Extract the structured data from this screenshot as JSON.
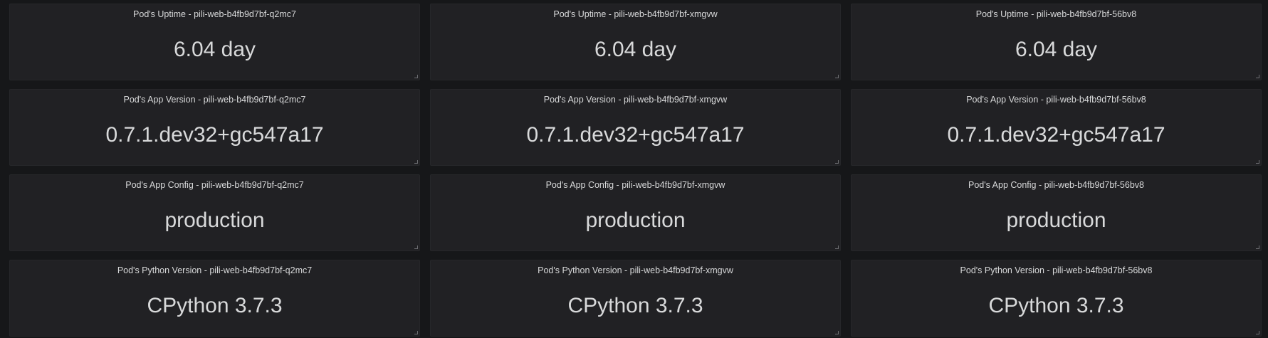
{
  "icons": {
    "resize": "resize-handle-icon"
  },
  "colors": {
    "background": "#161719",
    "panel": "#212124",
    "text": "#d8d9da"
  },
  "panels": [
    {
      "title": "Pod's Uptime - pili-web-b4fb9d7bf-q2mc7",
      "value": "6.04 day"
    },
    {
      "title": "Pod's Uptime - pili-web-b4fb9d7bf-xmgvw",
      "value": "6.04 day"
    },
    {
      "title": "Pod's Uptime - pili-web-b4fb9d7bf-56bv8",
      "value": "6.04 day"
    },
    {
      "title": "Pod's App Version - pili-web-b4fb9d7bf-q2mc7",
      "value": "0.7.1.dev32+gc547a17"
    },
    {
      "title": "Pod's App Version - pili-web-b4fb9d7bf-xmgvw",
      "value": "0.7.1.dev32+gc547a17"
    },
    {
      "title": "Pod's App Version - pili-web-b4fb9d7bf-56bv8",
      "value": "0.7.1.dev32+gc547a17"
    },
    {
      "title": "Pod's App Config - pili-web-b4fb9d7bf-q2mc7",
      "value": "production"
    },
    {
      "title": "Pod's App Config - pili-web-b4fb9d7bf-xmgvw",
      "value": "production"
    },
    {
      "title": "Pod's App Config - pili-web-b4fb9d7bf-56bv8",
      "value": "production"
    },
    {
      "title": "Pod's Python Version - pili-web-b4fb9d7bf-q2mc7",
      "value": "CPython 3.7.3"
    },
    {
      "title": "Pod's Python Version - pili-web-b4fb9d7bf-xmgvw",
      "value": "CPython 3.7.3"
    },
    {
      "title": "Pod's Python Version - pili-web-b4fb9d7bf-56bv8",
      "value": "CPython 3.7.3"
    }
  ]
}
